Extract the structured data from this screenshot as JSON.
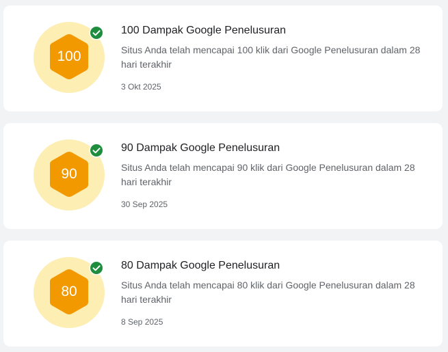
{
  "achievements": [
    {
      "badge_value": "100",
      "title": "100 Dampak Google Penelusuran",
      "description": "Situs Anda telah mencapai 100 klik dari Google Penelusuran dalam 28 hari terakhir",
      "date": "3 Okt 2025",
      "completed": true
    },
    {
      "badge_value": "90",
      "title": "90 Dampak Google Penelusuran",
      "description": "Situs Anda telah mencapai 90 klik dari Google Penelusuran dalam 28 hari terakhir",
      "date": "30 Sep 2025",
      "completed": true
    },
    {
      "badge_value": "80",
      "title": "80 Dampak Google Penelusuran",
      "description": "Situs Anda telah mencapai 80 klik dari Google Penelusuran dalam 28 hari terakhir",
      "date": "8 Sep 2025",
      "completed": true
    }
  ],
  "icons": {
    "badge": "hexagon-badge-icon",
    "status": "check-circle-icon"
  },
  "colors": {
    "page_background": "#f1f3f4",
    "card_background": "#ffffff",
    "badge_circle": "#fdeeb4",
    "badge_hexagon": "#f29900",
    "check_green": "#1e8e3e",
    "title_text": "#202124",
    "secondary_text": "#5f6368"
  }
}
